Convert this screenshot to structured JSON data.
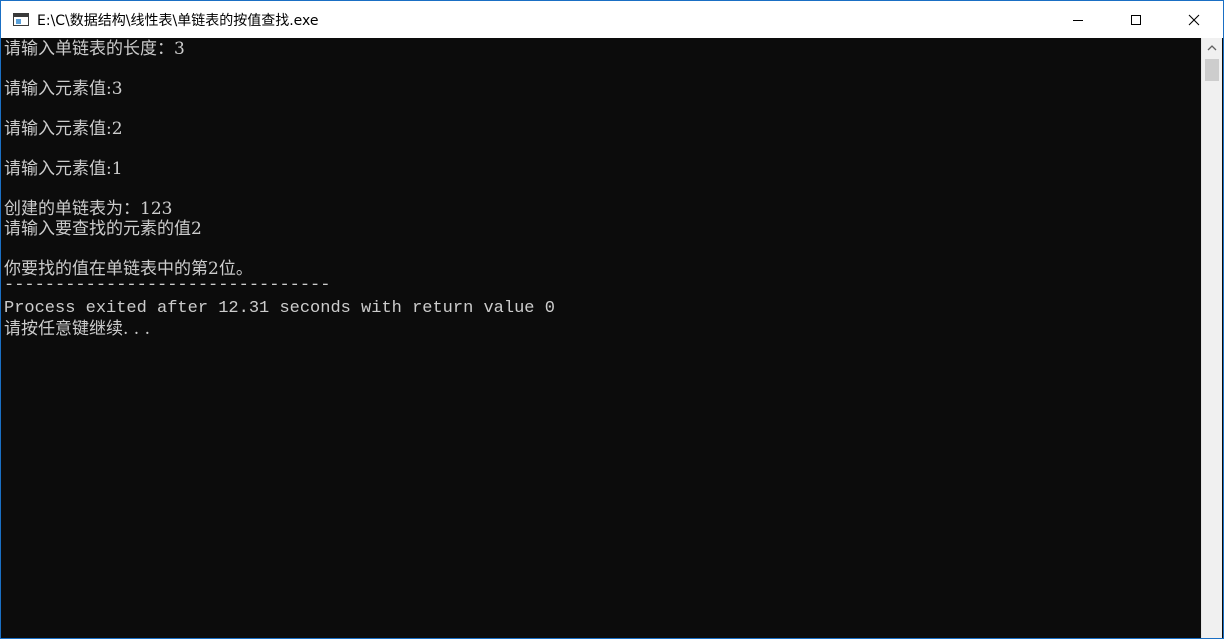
{
  "window": {
    "title": "E:\\C\\数据结构\\线性表\\单链表的按值查找.exe",
    "controls": {
      "minimize_icon": "minimize-icon",
      "maximize_icon": "maximize-icon",
      "close_icon": "close-icon"
    }
  },
  "console": {
    "lines": [
      "请输入单链表的长度：3",
      "请输入元素值:3",
      "请输入元素值:2",
      "请输入元素值:1",
      "创建的单链表为：123",
      "请输入要查找的元素的值2",
      "你要找的值在单链表中的第2位。",
      "--------------------------------",
      "Process exited after 12.31 seconds with return value 0",
      "请按任意键继续. . ."
    ]
  },
  "colors": {
    "console_bg": "#0c0c0c",
    "console_text": "#cccccc",
    "titlebar_bg": "#ffffff",
    "window_border": "#1a6fc4"
  }
}
